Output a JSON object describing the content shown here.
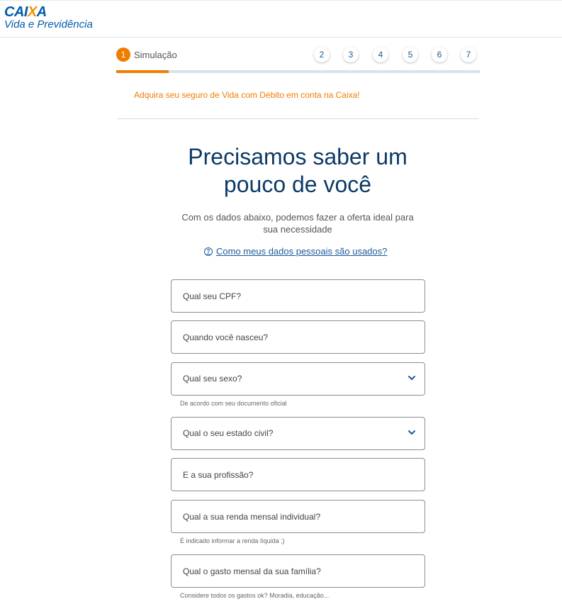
{
  "header": {
    "logo_brand_pre": "CAI",
    "logo_brand_x": "X",
    "logo_brand_post": "A",
    "logo_sub": "Vida e Previdência"
  },
  "stepper": {
    "active_number": "1",
    "active_label": "Simulação",
    "steps": [
      "2",
      "3",
      "4",
      "5",
      "6",
      "7"
    ],
    "progress_fraction": 0.145
  },
  "promo": "Adquira seu seguro de Vida com Débito em conta na Caixa!",
  "main": {
    "title_line1": "Precisamos saber um",
    "title_line2": "pouco de você",
    "subtitle_line1": "Com os dados abaixo, podemos fazer a oferta ideal para",
    "subtitle_line2": "sua necessidade",
    "privacy_icon": "?",
    "privacy_link": "Como meus dados pessoais são usados?"
  },
  "form": {
    "cpf_placeholder": "Qual seu CPF?",
    "birth_placeholder": "Quando você nasceu?",
    "sex_label": "Qual seu sexo?",
    "sex_hint": "De acordo com seu documento oficial",
    "civil_label": "Qual o seu estado civil?",
    "profession_placeholder": "E a sua profissão?",
    "income_placeholder": "Qual a sua renda mensal individual?",
    "income_hint": "É indicado informar a renda líquida ;)",
    "expense_placeholder": "Qual o gasto mensal da sua família?",
    "expense_hint": "Considere todos os gastos ok? Moradia, educação..."
  },
  "colors": {
    "accent": "#ef7d00",
    "brand_blue": "#005ca9",
    "title_blue": "#0d3a66"
  },
  "icons": {
    "dropdown": "chevron-down-icon",
    "help": "question-circle-icon"
  }
}
